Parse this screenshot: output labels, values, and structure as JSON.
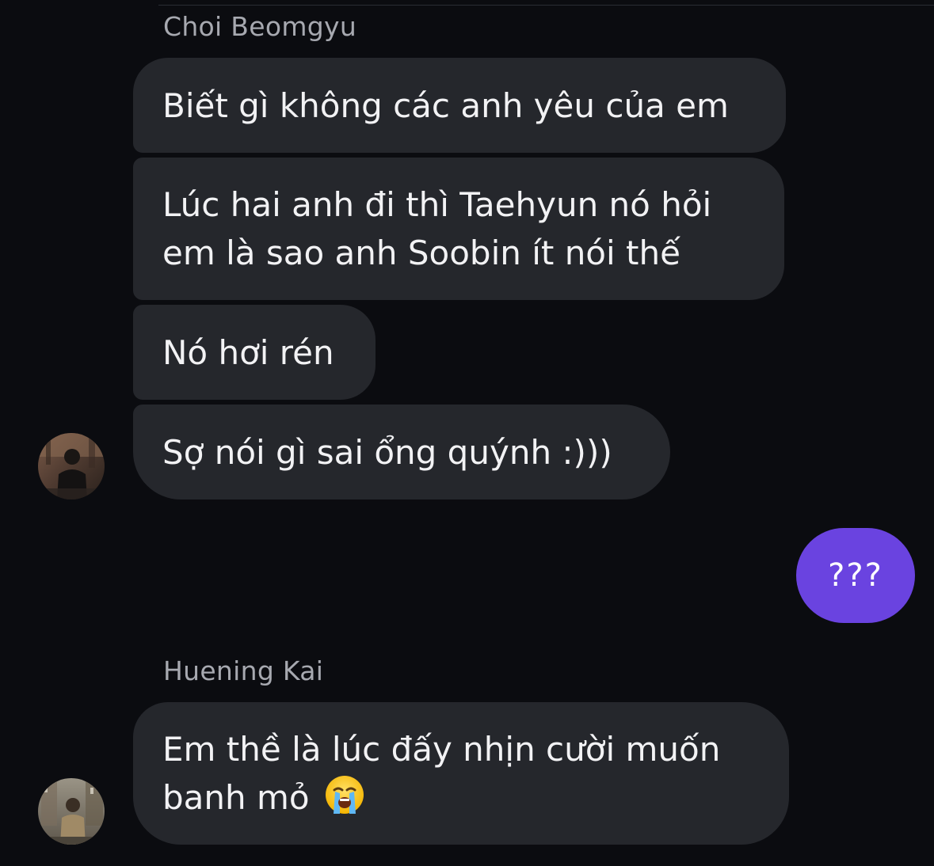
{
  "thread": {
    "groups": [
      {
        "sender": "Choi Beomgyu",
        "messages": [
          {
            "lines": [
              "Biết gì không các anh yêu của em"
            ]
          },
          {
            "lines": [
              "Lúc hai anh đi thì Taehyun nó hỏi",
              "em là sao anh Soobin ít nói thế"
            ]
          },
          {
            "lines": [
              "Nó hơi rén"
            ]
          },
          {
            "lines": [
              "Sợ nói gì sai ổng quýnh :)))"
            ]
          }
        ]
      },
      {
        "outgoing": true,
        "messages": [
          {
            "text": "???"
          }
        ]
      },
      {
        "sender": "Huening Kai",
        "messages": [
          {
            "lines": [
              "Em thề là lúc đấy nhịn cười muốn",
              "banh mỏ"
            ],
            "emoji": "loudly-crying-face-icon"
          }
        ]
      }
    ]
  },
  "colors": {
    "background": "#0b0c10",
    "incoming_bubble": "#25272c",
    "outgoing_bubble": "#6a43e0",
    "sender_name": "#a7a9b0",
    "text": "#f2f2f4"
  }
}
